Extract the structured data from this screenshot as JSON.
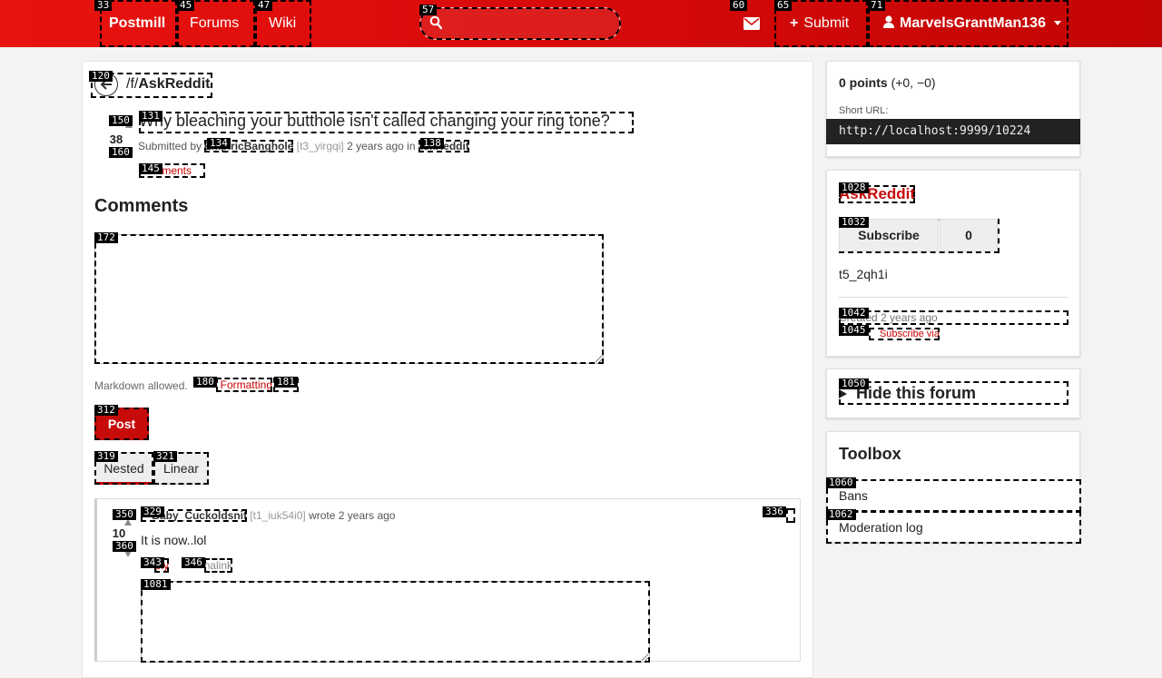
{
  "nav": {
    "brand": "Postmill",
    "forums": "Forums",
    "wiki": "Wiki",
    "search_placeholder": "",
    "submit": "Submit",
    "user": "MarvelsGrantMan136"
  },
  "labels": {
    "nav_brand": "33",
    "nav_forums": "45",
    "nav_wiki": "47",
    "search": "57",
    "mail": "60",
    "submit": "65",
    "user": "71",
    "forum_crumb": "120",
    "post_title": "131",
    "vote_up": "150",
    "vote_down": "160",
    "author": "134",
    "forum_link": "138",
    "comments_link": "145",
    "comment_textarea": "172",
    "format_help": "180",
    "small_link": "181",
    "post_btn": "312",
    "tab_nested": "319",
    "tab_linear": "321",
    "c_author": "329",
    "c_menu": "336",
    "c_vote_up": "350",
    "c_vote_down": "360",
    "c_action1": "343",
    "c_action2": "346",
    "reply_area": "1081",
    "forum_name": "1028",
    "subscribe": "1032",
    "created": "1042",
    "rss": "1045",
    "hide_forum": "1050",
    "bans": "1060",
    "modlog": "1062"
  },
  "post": {
    "forum_prefix": "/f/",
    "forum": "AskReddit",
    "title": "Why bleaching your butthole isn't called changing your ring tone?",
    "votes": "38",
    "submitted_by": "Submitted by",
    "author": "EmpiricBanghole",
    "id": "[t3_yirgqi]",
    "time": "2 years ago in",
    "forum_link": "AskReddit",
    "comments_link": "Comments"
  },
  "comments": {
    "heading": "Comments",
    "markdown_note": "Markdown allowed.",
    "format_help": "Formatting help",
    "post_button": "Post",
    "tab_nested": "Nested",
    "tab_linear": "Linear"
  },
  "comment": {
    "votes": "10",
    "author": "Baby_Cuckoldsnif",
    "id": "[t1_iuk54i0]",
    "wrote": "wrote 2 years ago",
    "body": "It is now..lol",
    "action1": "Reply",
    "action2": "Permalink"
  },
  "sidebar": {
    "points_bold": "0 points",
    "points_rest": "(+0, −0)",
    "short_url_label": "Short URL:",
    "short_url": "http://localhost:9999/10224",
    "forum_name": "AskReddit",
    "subscribe": "Subscribe",
    "subscribers": "0",
    "forum_id": "t5_2qh1i",
    "created": "Created 2 years ago",
    "rss": "Subscribe via RSS",
    "hide_forum": "Hide this forum",
    "toolbox": "Toolbox",
    "bans": "Bans",
    "modlog": "Moderation log"
  }
}
